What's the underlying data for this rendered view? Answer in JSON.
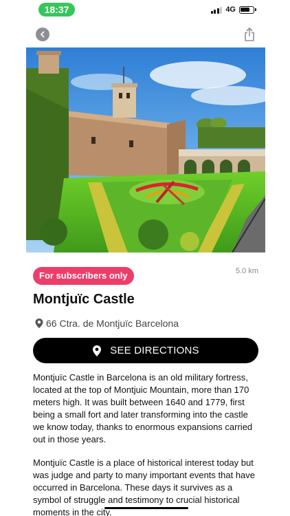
{
  "status_bar": {
    "time": "18:37",
    "network": "4G",
    "battery_level": 0.75
  },
  "nav": {
    "back_icon": "chevron-left-icon",
    "share_icon": "share-icon"
  },
  "hero": {
    "alt": "Montjuïc Castle"
  },
  "place": {
    "badge": "For subscribers only",
    "distance": "5.0 km",
    "title": "Montjuïc Castle",
    "address": "66 Ctra. de Montjuïc Barcelona",
    "directions_label": "SEE DIRECTIONS",
    "description_1": "Montjuïc Castle in Barcelona is an old military fortress, located at the top of Montjuic Mountain, more than 170 meters high. It was built between 1640 and 1779, first being a small fort and later transforming into the castle we know today, thanks to enormous expansions carried out in those years.",
    "description_2": "Montjuïc Castle is a place of historical interest today but was judge and party to many important events that have occurred in Barcelona. These days it survives as a symbol of struggle and testimony to crucial historical moments in the city."
  },
  "colors": {
    "badge": "#ec3e6b",
    "time_pill": "#34c759",
    "button": "#000000"
  }
}
